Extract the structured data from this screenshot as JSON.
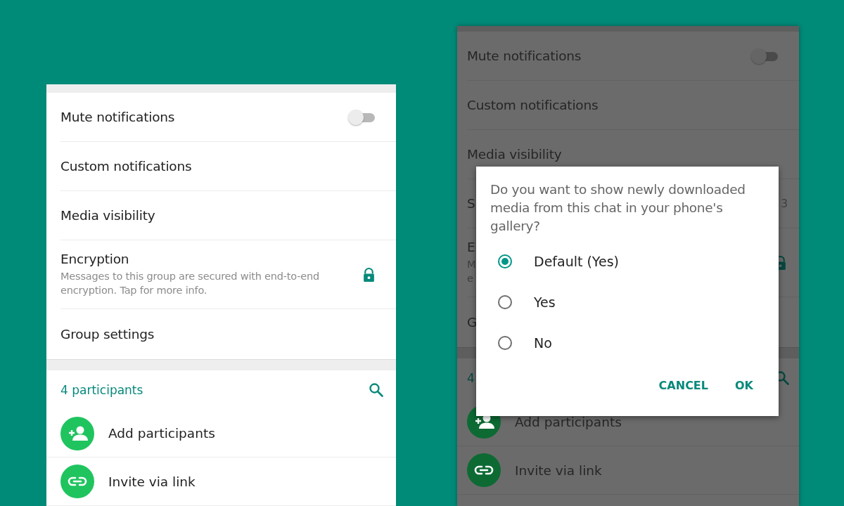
{
  "left_screen": {
    "dimmed": false,
    "settings": [
      {
        "kind": "toggle",
        "label": "Mute notifications",
        "on": false
      },
      {
        "kind": "plain",
        "label": "Custom notifications"
      },
      {
        "kind": "plain",
        "label": "Media visibility"
      },
      {
        "kind": "lock",
        "label": "Encryption",
        "subtitle_lines": [
          "Messages to this group are secured with end-to-end",
          "encryption. Tap for more info."
        ]
      },
      {
        "kind": "plain",
        "label": "Group settings"
      }
    ],
    "participants": {
      "count_label": "4 participants",
      "actions": [
        {
          "kind": "add",
          "label": "Add participants"
        },
        {
          "kind": "link",
          "label": "Invite via link"
        }
      ]
    }
  },
  "right_screen": {
    "dimmed": true,
    "settings": [
      {
        "kind": "toggle",
        "label": "Mute notifications",
        "on": false
      },
      {
        "kind": "plain",
        "label": "Custom notifications"
      },
      {
        "kind": "plain",
        "label": "Media visibility"
      },
      {
        "kind": "value",
        "label": "S",
        "value": "3"
      },
      {
        "kind": "lock",
        "label": "E",
        "subtitle_lines": [
          "M",
          "e"
        ]
      },
      {
        "kind": "plain",
        "label": "G"
      }
    ],
    "participants": {
      "count_label": "4",
      "actions": [
        {
          "kind": "add",
          "label": "Add participants"
        },
        {
          "kind": "link",
          "label": "Invite via link"
        }
      ]
    },
    "dialog": {
      "message": "Do you want to show newly downloaded media from this chat in your phone's gallery?",
      "options": [
        {
          "label": "Default (Yes)",
          "selected": true
        },
        {
          "label": "Yes",
          "selected": false
        },
        {
          "label": "No",
          "selected": false
        }
      ],
      "buttons": [
        "CANCEL",
        "OK"
      ]
    }
  }
}
